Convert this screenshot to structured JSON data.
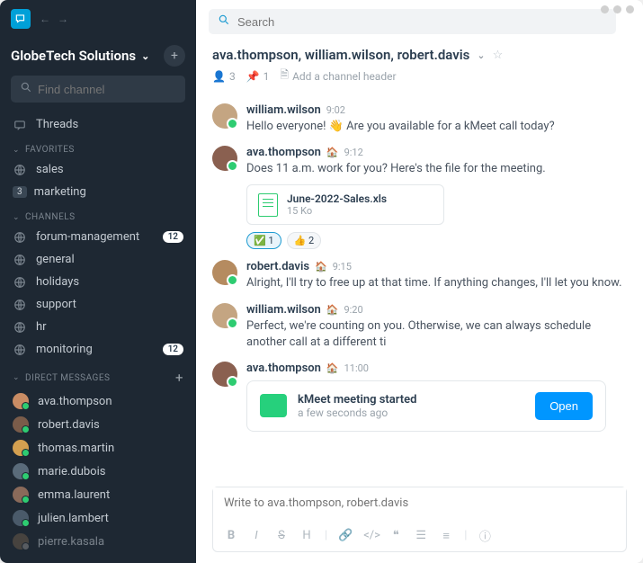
{
  "workspace": {
    "name": "GlobeTech Solutions"
  },
  "sidebar": {
    "find_placeholder": "Find channel",
    "threads_label": "Threads",
    "fav_heading": "FAVORITES",
    "favorites": [
      {
        "label": "sales"
      },
      {
        "label": "marketing",
        "count": "3"
      }
    ],
    "ch_heading": "CHANNELS",
    "channels": [
      {
        "label": "forum-management",
        "badge": "12"
      },
      {
        "label": "general"
      },
      {
        "label": "holidays"
      },
      {
        "label": "support"
      },
      {
        "label": "hr"
      },
      {
        "label": "monitoring",
        "badge": "12"
      }
    ],
    "dm_heading": "DIRECT MESSAGES",
    "dms": [
      {
        "label": "ava.thompson"
      },
      {
        "label": "robert.davis"
      },
      {
        "label": "thomas.martin"
      },
      {
        "label": "marie.dubois"
      },
      {
        "label": "emma.laurent"
      },
      {
        "label": "julien.lambert"
      },
      {
        "label": "pierre.kasala"
      }
    ]
  },
  "search": {
    "placeholder": "Search"
  },
  "header": {
    "title": "ava.thompson, william.wilson, robert.davis",
    "members": "3",
    "pinned": "1",
    "topic_placeholder": "Add a channel header"
  },
  "messages": [
    {
      "name": "william.wilson",
      "role": "",
      "time": "9:02",
      "text": "Hello everyone! 👋 Are you available for a kMeet call today?"
    },
    {
      "name": "ava.thompson",
      "role": "🏠",
      "time": "9:12",
      "text": "Does 11 a.m. work for you? Here's the file for the meeting.",
      "file": {
        "name": "June-2022-Sales.xls",
        "size": "15 Ko"
      },
      "reactions": [
        {
          "emoji": "✅",
          "count": "1",
          "on": true
        },
        {
          "emoji": "👍",
          "count": "2",
          "on": false
        }
      ]
    },
    {
      "name": "robert.davis",
      "role": "🏠",
      "time": "9:15",
      "text": "Alright, I'll try to free up at that time. If anything changes, I'll let you know."
    },
    {
      "name": "william.wilson",
      "role": "🏠",
      "time": "9:20",
      "text": "Perfect, we're counting on you. Otherwise, we can always schedule another call at a different ti"
    },
    {
      "name": "ava.thompson",
      "role": "🏠",
      "time": "11:00",
      "text": "",
      "meeting": {
        "title": "kMeet meeting started",
        "sub": "a few seconds ago",
        "button": "Open"
      }
    }
  ],
  "composer": {
    "placeholder": "Write to ava.thompson, robert.davis"
  }
}
